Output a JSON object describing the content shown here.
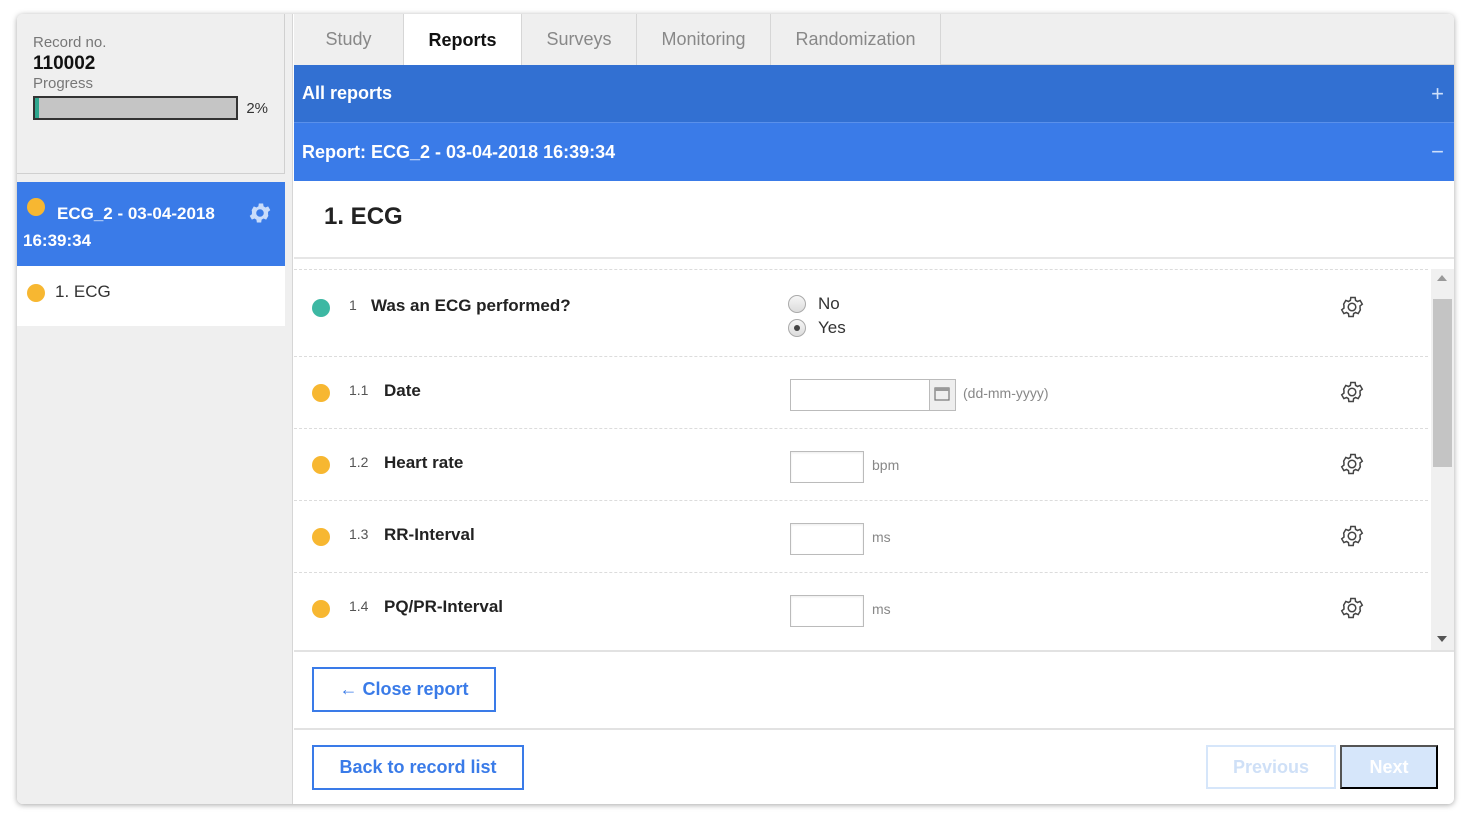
{
  "sidebar": {
    "record_label": "Record no.",
    "record_no": "110002",
    "progress_label": "Progress",
    "progress_value": 0.02,
    "progress_text": "2%",
    "active_item": {
      "title": "ECG_2 - 03-04-2018 16:39:34",
      "status_color": "#f7b731",
      "icon": "gear-icon"
    },
    "items": [
      {
        "label": "1. ECG",
        "status_color": "#f7b731"
      }
    ]
  },
  "tabs": [
    {
      "label": "Study"
    },
    {
      "label": "Reports",
      "active": true
    },
    {
      "label": "Surveys"
    },
    {
      "label": "Monitoring"
    },
    {
      "label": "Randomization"
    }
  ],
  "all_reports_bar": {
    "label": "All reports",
    "sign": "+"
  },
  "report_bar": {
    "label": "Report: ECG_2 - 03-04-2018 16:39:34",
    "sign": "−"
  },
  "section_title": "1. ECG",
  "questions": [
    {
      "num": "1",
      "label": "Was an ECG performed?",
      "type": "radio",
      "options": [
        "No",
        "Yes"
      ],
      "selected": "Yes",
      "status_color": "#3db8a3"
    },
    {
      "num": "1.1",
      "label": "Date",
      "type": "date",
      "value": "",
      "hint": "(dd-mm-yyyy)",
      "status_color": "#f7b731"
    },
    {
      "num": "1.2",
      "label": "Heart rate",
      "type": "number",
      "value": "",
      "unit": "bpm",
      "status_color": "#f7b731"
    },
    {
      "num": "1.3",
      "label": "RR-Interval",
      "type": "number",
      "value": "",
      "unit": "ms",
      "status_color": "#f7b731"
    },
    {
      "num": "1.4",
      "label": "PQ/PR-Interval",
      "type": "number",
      "value": "",
      "unit": "ms",
      "status_color": "#f7b731"
    }
  ],
  "buttons": {
    "close_report": "← Close report",
    "back_to_list": "Back to record list",
    "previous": "Previous",
    "next": "Next"
  },
  "colors": {
    "accent": "#3a7be8",
    "header_dark": "#3270d2",
    "status_pending": "#f7b731",
    "status_done": "#3db8a3"
  }
}
